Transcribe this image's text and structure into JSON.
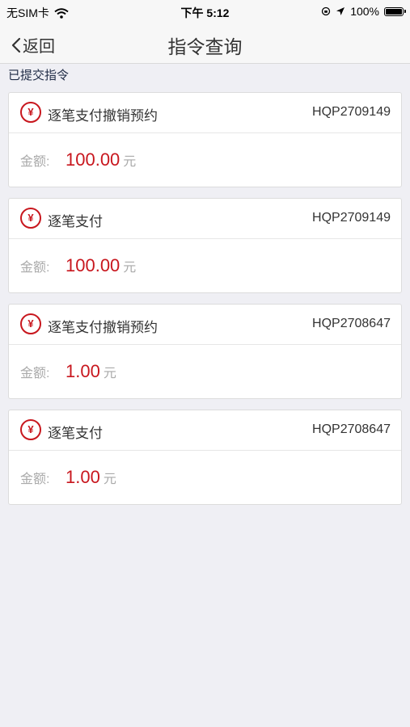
{
  "status": {
    "carrier": "无SIM卡",
    "time": "下午 5:12",
    "battery": "100%"
  },
  "nav": {
    "back_label": "返回",
    "title": "指令查询"
  },
  "section_label": "已提交指令",
  "icon_glyph": "¥",
  "amount_label": "金额:",
  "unit": "元",
  "cards": [
    {
      "title": "逐笔支付撤销预约",
      "code": "HQP2709149",
      "amount": "100.00"
    },
    {
      "title": "逐笔支付",
      "code": "HQP2709149",
      "amount": "100.00"
    },
    {
      "title": "逐笔支付撤销预约",
      "code": "HQP2708647",
      "amount": "1.00"
    },
    {
      "title": "逐笔支付",
      "code": "HQP2708647",
      "amount": "1.00"
    }
  ],
  "colors": {
    "accent": "#c8171e",
    "background": "#efeff4"
  }
}
